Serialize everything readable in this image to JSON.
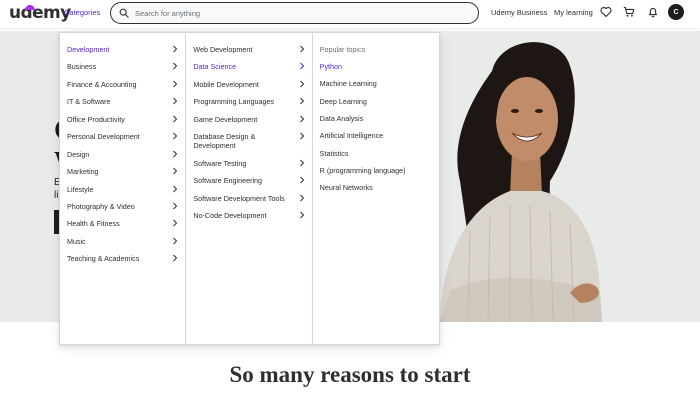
{
  "header": {
    "logo": "udemy",
    "categories_label": "Categories",
    "search_placeholder": "Search for anything",
    "udemy_business": "Udemy Business",
    "my_learning": "My learning",
    "avatar_initial": "C",
    "icons": [
      "search-icon",
      "heart-icon",
      "cart-icon",
      "bell-icon"
    ]
  },
  "hero": {
    "fragments": [
      "G",
      "W",
      "E",
      "li"
    ]
  },
  "menu": {
    "categories": [
      {
        "label": "Development",
        "active": true
      },
      {
        "label": "Business"
      },
      {
        "label": "Finance & Accounting"
      },
      {
        "label": "IT & Software"
      },
      {
        "label": "Office Productivity"
      },
      {
        "label": "Personal Development"
      },
      {
        "label": "Design"
      },
      {
        "label": "Marketing"
      },
      {
        "label": "Lifestyle"
      },
      {
        "label": "Photography & Video"
      },
      {
        "label": "Health & Fitness"
      },
      {
        "label": "Music"
      },
      {
        "label": "Teaching & Academics"
      }
    ],
    "subcategories": [
      {
        "label": "Web Development"
      },
      {
        "label": "Data Science",
        "active": true
      },
      {
        "label": "Mobile Development"
      },
      {
        "label": "Programming Languages"
      },
      {
        "label": "Game Development"
      },
      {
        "label": "Database Design & Development"
      },
      {
        "label": "Software Testing"
      },
      {
        "label": "Software Engineering"
      },
      {
        "label": "Software Development Tools"
      },
      {
        "label": "No-Code Development"
      }
    ],
    "popular_title": "Popular topics",
    "popular_topics": [
      {
        "label": "Python",
        "active": true
      },
      {
        "label": "Machine Learning"
      },
      {
        "label": "Deep Learning"
      },
      {
        "label": "Data Analysis"
      },
      {
        "label": "Artificial Intelligence"
      },
      {
        "label": "Statistics"
      },
      {
        "label": "R (programming language)"
      },
      {
        "label": "Neural Networks"
      }
    ]
  },
  "tagline": "So many reasons to start",
  "colors": {
    "accent": "#5624d0",
    "brand": "#a435f0",
    "text": "#2d2f31",
    "hero_bg": "#e9eaea"
  }
}
